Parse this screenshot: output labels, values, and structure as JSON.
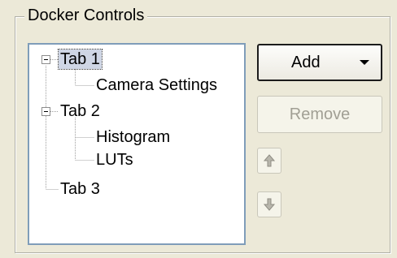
{
  "group": {
    "title": "Docker Controls"
  },
  "tree": {
    "nodes": [
      {
        "label": "Tab 1",
        "level": 0,
        "expanded": true,
        "selected": true
      },
      {
        "label": "Camera Settings",
        "level": 1
      },
      {
        "label": "Tab 2",
        "level": 0,
        "expanded": true
      },
      {
        "label": "Histogram",
        "level": 1
      },
      {
        "label": "LUTs",
        "level": 1
      },
      {
        "label": "Tab 3",
        "level": 0
      }
    ]
  },
  "buttons": {
    "add_label": "Add",
    "remove_label": "Remove",
    "move_up_icon": "arrow-up-icon",
    "move_down_icon": "arrow-down-icon"
  }
}
